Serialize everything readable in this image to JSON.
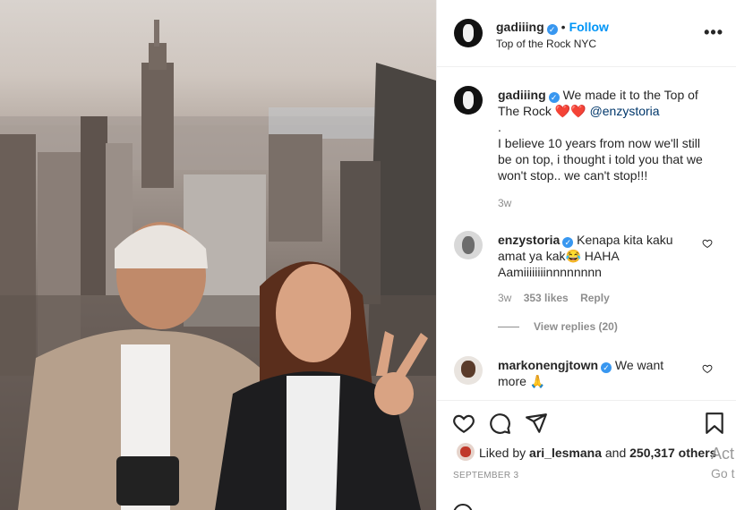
{
  "post": {
    "username": "gadiiing",
    "follow_label": "Follow",
    "location": "Top of the Rock NYC",
    "more_label": "•••"
  },
  "caption": {
    "username": "gadiiing",
    "line1": "We made it to the Top of",
    "line2": "The Rock ❤️❤️",
    "mention": "@enzystoria",
    "line3": ".",
    "line4": "I believe 10 years from now we'll still",
    "line5": "be on top, i thought i told you that we",
    "line6": "won't stop.. we can't stop!!!",
    "time": "3w"
  },
  "comments": [
    {
      "username": "enzystoria",
      "line1": "Kenapa kita kaku",
      "line2": "amat ya kak😂 HAHA",
      "line3": "Aamiiiiiiiinnnnnnnn",
      "time": "3w",
      "likes": "353 likes",
      "reply_label": "Reply",
      "view_replies": "View replies (20)"
    },
    {
      "username": "markonengjtown",
      "line1": "We want",
      "line2": "more 🙏"
    }
  ],
  "footer": {
    "liked_by_prefix": "Liked by",
    "liked_by_user": "ari_lesmana",
    "liked_by_and": "and",
    "liked_by_count": "250,317 others",
    "date": "SEPTEMBER 3",
    "activate_line1": "Act",
    "activate_line2": "Go t"
  },
  "icons": {
    "heart": "heart-icon",
    "comment": "comment-icon",
    "share": "share-icon",
    "bookmark": "bookmark-icon",
    "more": "more-options-icon"
  },
  "colors": {
    "follow_blue": "#0095f6",
    "verified_blue": "#3897f0",
    "muted": "#8e8e8e"
  }
}
